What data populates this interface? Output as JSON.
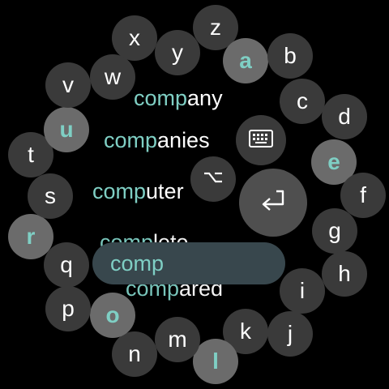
{
  "keys": [
    {
      "id": "z",
      "label": "z",
      "hl": false
    },
    {
      "id": "a",
      "label": "a",
      "hl": true
    },
    {
      "id": "b",
      "label": "b",
      "hl": false
    },
    {
      "id": "c",
      "label": "c",
      "hl": false
    },
    {
      "id": "d",
      "label": "d",
      "hl": false
    },
    {
      "id": "e",
      "label": "e",
      "hl": true
    },
    {
      "id": "f",
      "label": "f",
      "hl": false
    },
    {
      "id": "g",
      "label": "g",
      "hl": false
    },
    {
      "id": "h",
      "label": "h",
      "hl": false
    },
    {
      "id": "i",
      "label": "i",
      "hl": false
    },
    {
      "id": "j",
      "label": "j",
      "hl": false
    },
    {
      "id": "k",
      "label": "k",
      "hl": false
    },
    {
      "id": "l",
      "label": "l",
      "hl": true
    },
    {
      "id": "m",
      "label": "m",
      "hl": false
    },
    {
      "id": "n",
      "label": "n",
      "hl": false
    },
    {
      "id": "o",
      "label": "o",
      "hl": true
    },
    {
      "id": "p",
      "label": "p",
      "hl": false
    },
    {
      "id": "q",
      "label": "q",
      "hl": false
    },
    {
      "id": "r",
      "label": "r",
      "hl": true
    },
    {
      "id": "s",
      "label": "s",
      "hl": false
    },
    {
      "id": "t",
      "label": "t",
      "hl": false
    },
    {
      "id": "u",
      "label": "u",
      "hl": true
    },
    {
      "id": "v",
      "label": "v",
      "hl": false
    },
    {
      "id": "w",
      "label": "w",
      "hl": false
    },
    {
      "id": "x",
      "label": "x",
      "hl": false
    },
    {
      "id": "y",
      "label": "y",
      "hl": false
    }
  ],
  "suggestions": [
    {
      "prefix": "comp",
      "rest": "any"
    },
    {
      "prefix": "comp",
      "rest": "anies"
    },
    {
      "prefix": "comp",
      "rest": "uter"
    },
    {
      "prefix": "comp",
      "rest": "lete"
    },
    {
      "prefix": "comp",
      "rest": "ared"
    }
  ],
  "composing_text": "comp",
  "icons": {
    "keyboard": "keyboard-icon",
    "option": "option-key-icon",
    "enter": "enter-icon"
  },
  "colors": {
    "highlight": "#7fcfc4",
    "key_bg": "#3a3a3a",
    "key_hl_bg": "#6b6b6b",
    "composing_bg": "#38474d"
  }
}
